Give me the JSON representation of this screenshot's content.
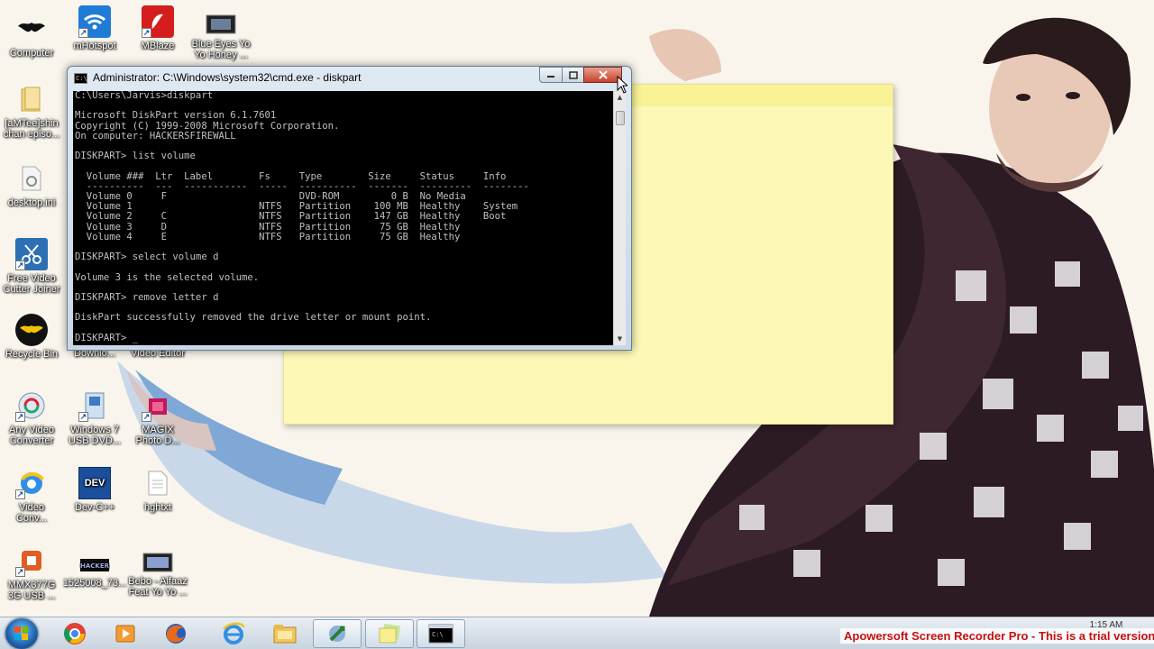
{
  "desktop": {
    "icons": [
      {
        "label": "Computer"
      },
      {
        "label": "mHotspot"
      },
      {
        "label": "MBlaze"
      },
      {
        "label": "Blue Eyes Yo\nYo Honey ..."
      },
      {
        "label": "[aMTee]shin\nchan episo..."
      },
      {
        "label": "desktop.ini"
      },
      {
        "label": "Free Video\nCutter Joiner"
      },
      {
        "label": "Recycle Bin"
      },
      {
        "label": "Internet\nDownlo..."
      },
      {
        "label": "VideoPad\nVideo Editor"
      },
      {
        "label": "Any Video\nConverter"
      },
      {
        "label": "Windows 7\nUSB DVD..."
      },
      {
        "label": "MAGIX\nPhoto D..."
      },
      {
        "label": "Video\nConv..."
      },
      {
        "label": "Dev-C++"
      },
      {
        "label": "hghtxt"
      },
      {
        "label": "MMX377G\n3G USB ..."
      },
      {
        "label": "1525008_73..."
      },
      {
        "label": "Bebo - Alfaaz\nFeat Yo Yo ..."
      }
    ]
  },
  "cmd_window": {
    "title": "Administrator: C:\\Windows\\system32\\cmd.exe - diskpart",
    "icon_label": "C:\\",
    "buttons": {
      "minimize": "minimize-icon",
      "maximize": "maximize-icon",
      "close": "close-icon"
    },
    "console_text": "C:\\Users\\Jarvis>diskpart\n\nMicrosoft DiskPart version 6.1.7601\nCopyright (C) 1999-2008 Microsoft Corporation.\nOn computer: HACKERSFIREWALL\n\nDISKPART> list volume\n\n  Volume ###  Ltr  Label        Fs     Type        Size     Status     Info\n  ----------  ---  -----------  -----  ----------  -------  ---------  --------\n  Volume 0     F                       DVD-ROM         0 B  No Media\n  Volume 1                      NTFS   Partition    100 MB  Healthy    System\n  Volume 2     C                NTFS   Partition    147 GB  Healthy    Boot\n  Volume 3     D                NTFS   Partition     75 GB  Healthy\n  Volume 4     E                NTFS   Partition     75 GB  Healthy\n\nDISKPART> select volume d\n\nVolume 3 is the selected volume.\n\nDISKPART> remove letter d\n\nDiskPart successfully removed the drive letter or mount point.\n\nDISKPART> _"
  },
  "taskbar": {
    "items": [
      {
        "name": "chrome-icon"
      },
      {
        "name": "media-player-icon"
      },
      {
        "name": "firefox-icon"
      },
      {
        "name": "internet-explorer-icon"
      },
      {
        "name": "file-explorer-icon"
      },
      {
        "name": "network-tool-icon"
      },
      {
        "name": "sticky-notes-icon"
      },
      {
        "name": "cmd-icon"
      }
    ],
    "clock": "1:15 AM"
  },
  "watermark": "Apowersoft Screen Recorder Pro - This is a trial version",
  "colors": {
    "console_bg": "#000000",
    "console_text": "#c0c0c0",
    "sticky_note": "#fdf8b6",
    "watermark_text": "#c81010"
  }
}
